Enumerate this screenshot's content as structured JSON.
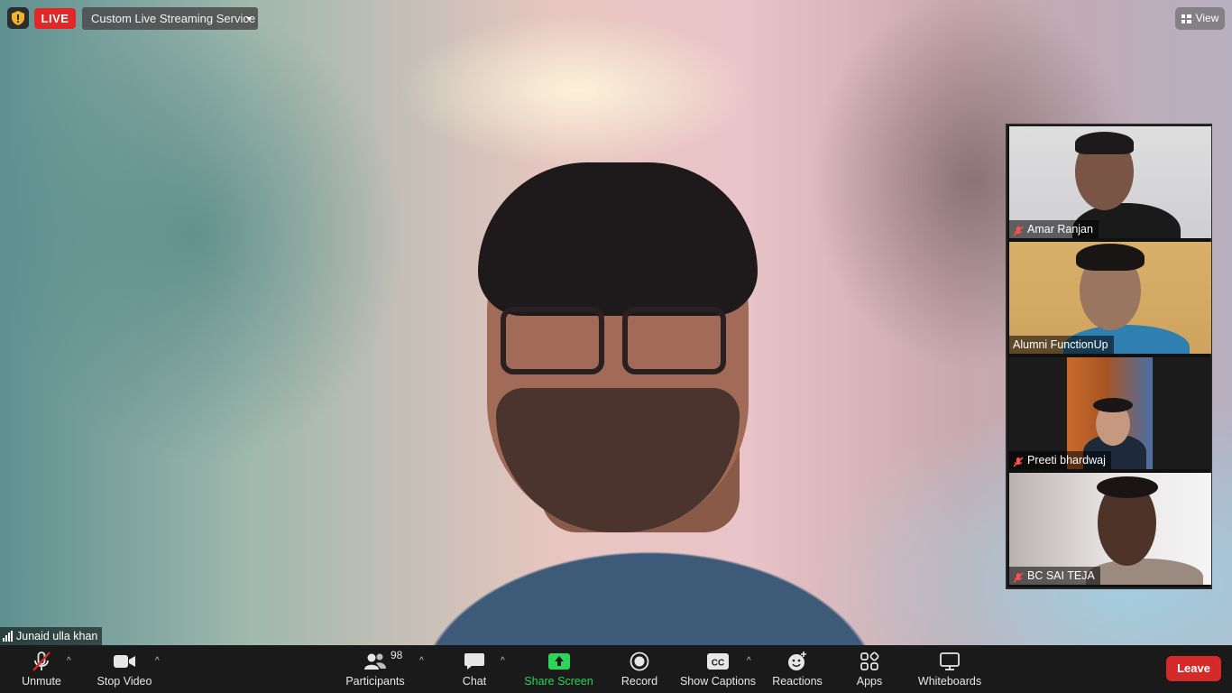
{
  "top_bar": {
    "live_label": "LIVE",
    "stream_service": "Custom Live Streaming Service",
    "view_label": "View"
  },
  "main_speaker": {
    "name": "Junaid ulla khan"
  },
  "gallery": {
    "tiles": [
      {
        "name": "Amar Ranjan",
        "muted": true
      },
      {
        "name": "Alumni FunctionUp",
        "muted": false
      },
      {
        "name": "Preeti bhardwaj",
        "muted": true
      },
      {
        "name": "BC SAI TEJA",
        "muted": true
      }
    ]
  },
  "toolbar": {
    "unmute": "Unmute",
    "stop_video": "Stop Video",
    "participants": "Participants",
    "participants_count": "98",
    "chat": "Chat",
    "share_screen": "Share Screen",
    "record": "Record",
    "show_captions": "Show Captions",
    "captions_icon_text": "CC",
    "reactions": "Reactions",
    "apps": "Apps",
    "whiteboards": "Whiteboards",
    "leave": "Leave"
  },
  "colors": {
    "live_red": "#e02828",
    "leave_red": "#d52a2a",
    "share_green": "#2dd35b",
    "toolbar_bg": "#1a1a1a"
  }
}
